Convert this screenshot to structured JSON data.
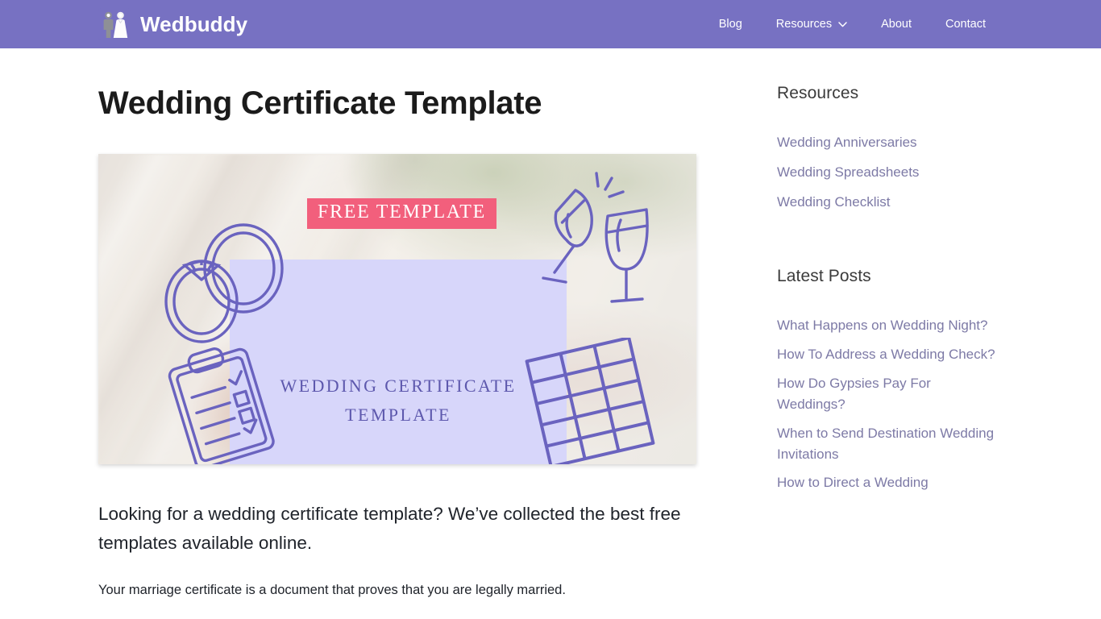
{
  "header": {
    "brand_name": "Wedbuddy",
    "logo_icon": "bride-and-groom-icon",
    "background_color": "#7771c2",
    "nav": [
      {
        "label": "Blog",
        "has_dropdown": false
      },
      {
        "label": "Resources",
        "has_dropdown": true,
        "chevron_icon": "chevron-down-icon"
      },
      {
        "label": "About",
        "has_dropdown": false
      },
      {
        "label": "Contact",
        "has_dropdown": false
      }
    ]
  },
  "main": {
    "title": "Wedding Certificate Template",
    "featured_image": {
      "badge_text": "FREE TEMPLATE",
      "badge_color": "#f25f7c",
      "card_color": "#d7d6fa",
      "card_line_1": "WEDDING CERTIFICATE",
      "card_line_2": "TEMPLATE",
      "card_text_color": "#5d58ad",
      "decorations": [
        "wedding-rings-icon",
        "champagne-glasses-icon",
        "clipboard-checklist-icon",
        "spreadsheet-grid-icon"
      ]
    },
    "lead_paragraph": "Looking for a wedding certificate template? We’ve collected the best free templates available online.",
    "paragraph_1": "Your marriage certificate is a document that proves that you are legally married."
  },
  "sidebar": {
    "resources": {
      "title": "Resources",
      "links": [
        "Wedding Anniversaries",
        "Wedding Spreadsheets",
        "Wedding Checklist"
      ]
    },
    "latest_posts": {
      "title": "Latest Posts",
      "links": [
        "What Happens on Wedding Night?",
        "How To Address a Wedding Check?",
        "How Do Gypsies Pay For Weddings?",
        "When to Send Destination Wedding Invitations",
        "How to Direct a Wedding"
      ]
    },
    "link_color": "#7d7aa6"
  }
}
